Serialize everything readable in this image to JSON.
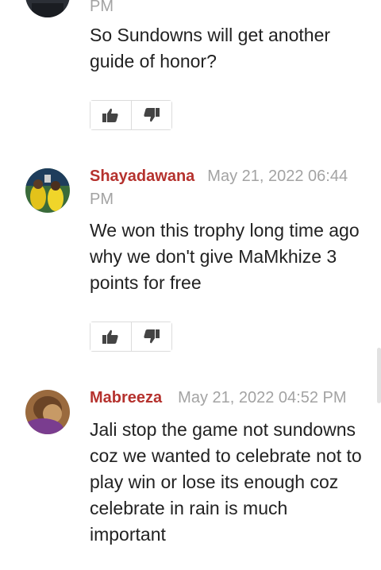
{
  "comments": [
    {
      "author": "",
      "time": "PM",
      "text": "So Sundowns will get another guide of honor?"
    },
    {
      "author": "Shayadawana",
      "time": "May 21, 2022 06:44 PM",
      "text": "We won this trophy long time ago why we don't give MaMkhize 3 points for free"
    },
    {
      "author": "Mabreeza",
      "time": "May 21, 2022 04:52 PM",
      "text": "Jali stop the game not sundowns coz we wanted to celebrate not to play win or lose its enough coz celebrate in rain is much important"
    }
  ],
  "colors": {
    "author": "#b5322e",
    "timestamp": "#a3a3a3",
    "text": "#222222",
    "icon": "#444444"
  },
  "icons": {
    "like": "thumbs-up-icon",
    "dislike": "thumbs-down-icon"
  }
}
